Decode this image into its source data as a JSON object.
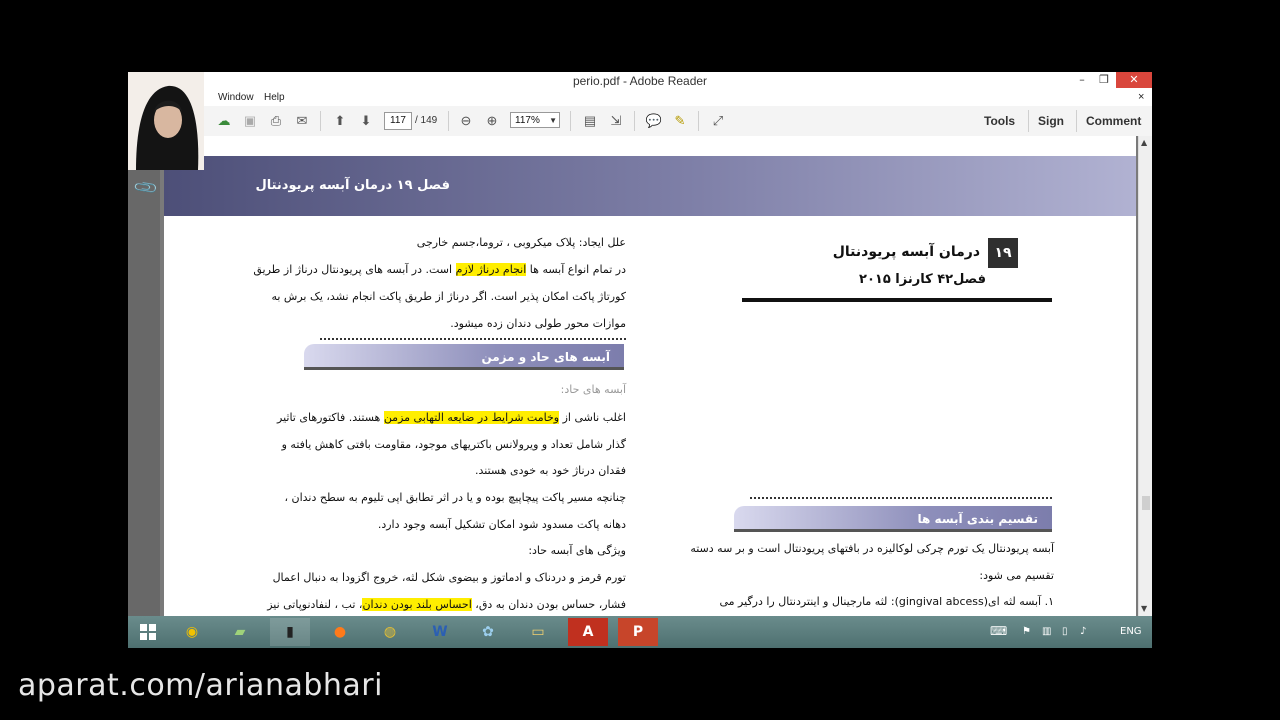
{
  "window": {
    "title": "perio.pdf - Adobe Reader",
    "minimize_glyph": "–",
    "maximize_glyph": "❐",
    "close_glyph": "✕"
  },
  "menu": {
    "items": [
      "Window",
      "Help"
    ],
    "close_glyph": "×"
  },
  "toolbar": {
    "current_page": "117",
    "total_pages": "/ 149",
    "zoom": "117%",
    "tools_label": "Tools",
    "sign_label": "Sign",
    "comment_label": "Comment",
    "icons": [
      "cloud-upload-icon",
      "save-icon",
      "print-icon",
      "email-icon",
      "page-up-icon",
      "page-down-icon",
      "zoom-out-icon",
      "zoom-in-icon",
      "fit-page-icon",
      "fit-width-icon",
      "comment-bubble-icon",
      "highlight-icon",
      "fullscreen-icon"
    ]
  },
  "document": {
    "header_title": "فصل ۱۹ درمان آبسه پریودنتال",
    "chapter_number": "۱۹",
    "chapter_title": "درمان آبسه پریودنتال",
    "chapter_subtitle": "فصل۴۲ کارنزا ۲۰۱۵",
    "right_section_heading": "تقسیم بندی آبسه ها",
    "right_para_1": "آبسه پریودنتال یک تورم چرکی لوکالیزه در بافتهای پریودنتال است و بر سه دسته",
    "right_para_2": "تقسیم می شود:",
    "right_para_3": "۱.  آبسه لثه ای(gingival abcess):  لثه مارجینال و اینتردنتال را درگیر می",
    "left_line_1": "علل ایجاد: پلاک میکروبی ، تروما،جسم خارجی",
    "left_line_2_a": "در تمام انواع آبسه ها ",
    "left_line_2_hl": "انجام درناژ لازم",
    "left_line_2_b": " است. در آبسه های پریودنتال درناژ از طریق",
    "left_line_3": "کورتاژ پاکت امکان پذیر است. اگر درناژ از طریق پاکت انجام نشد، یک برش به",
    "left_line_4": "موازات محور طولی دندان زده میشود.",
    "left_section_heading": "آبسه های حاد و مزمن",
    "acute_label": "آبسه های حاد:",
    "acute_1_a": "اغلب ناشی از ",
    "acute_1_hl": "وخامت شرایط در ضایعه التهابی مزمن",
    "acute_1_b": " هستند. فاکتورهای تاثیر",
    "acute_2": "گذار شامل تعداد و ویرولانس باکتریهای موجود، مقاومت بافتی کاهش یافته و",
    "acute_3": "فقدان درناژ خود به خودی هستند.",
    "acute_4": "چنانچه مسیر پاکت پیچاپیچ بوده و یا در اثر تطابق اپی تلیوم به سطح دندان ،",
    "acute_5": "دهانه پاکت مسدود شود امکان تشکیل آبسه وجود دارد.",
    "features_label": "ویژگی های آبسه حاد:",
    "feat_1": "تورم قرمز و دردناک و ادماتوز و بیضوی شکل لثه، خروج اگزودا به دنبال اعمال",
    "feat_2_a": "فشار، حساس بودن دندان به دق، ",
    "feat_2_hl": "احساس بلند بودن دندان",
    "feat_2_b": "، تب ، لنفادنوپاتی نیز"
  },
  "taskbar": {
    "language": "ENG",
    "apps": [
      "start-icon",
      "chrome-like-icon",
      "folder-green-icon",
      "tablet-icon",
      "firefox-icon",
      "chrome-icon",
      "word-icon",
      "paint-icon",
      "explorer-icon",
      "acrobat-icon",
      "powerpoint-icon"
    ]
  },
  "watermark": "aparat.com/arianabhari",
  "colors": {
    "header_band": "#4d4f78",
    "highlight": "#ffee00",
    "close_red": "#d9463c",
    "taskbar": "#5a7c7c"
  }
}
